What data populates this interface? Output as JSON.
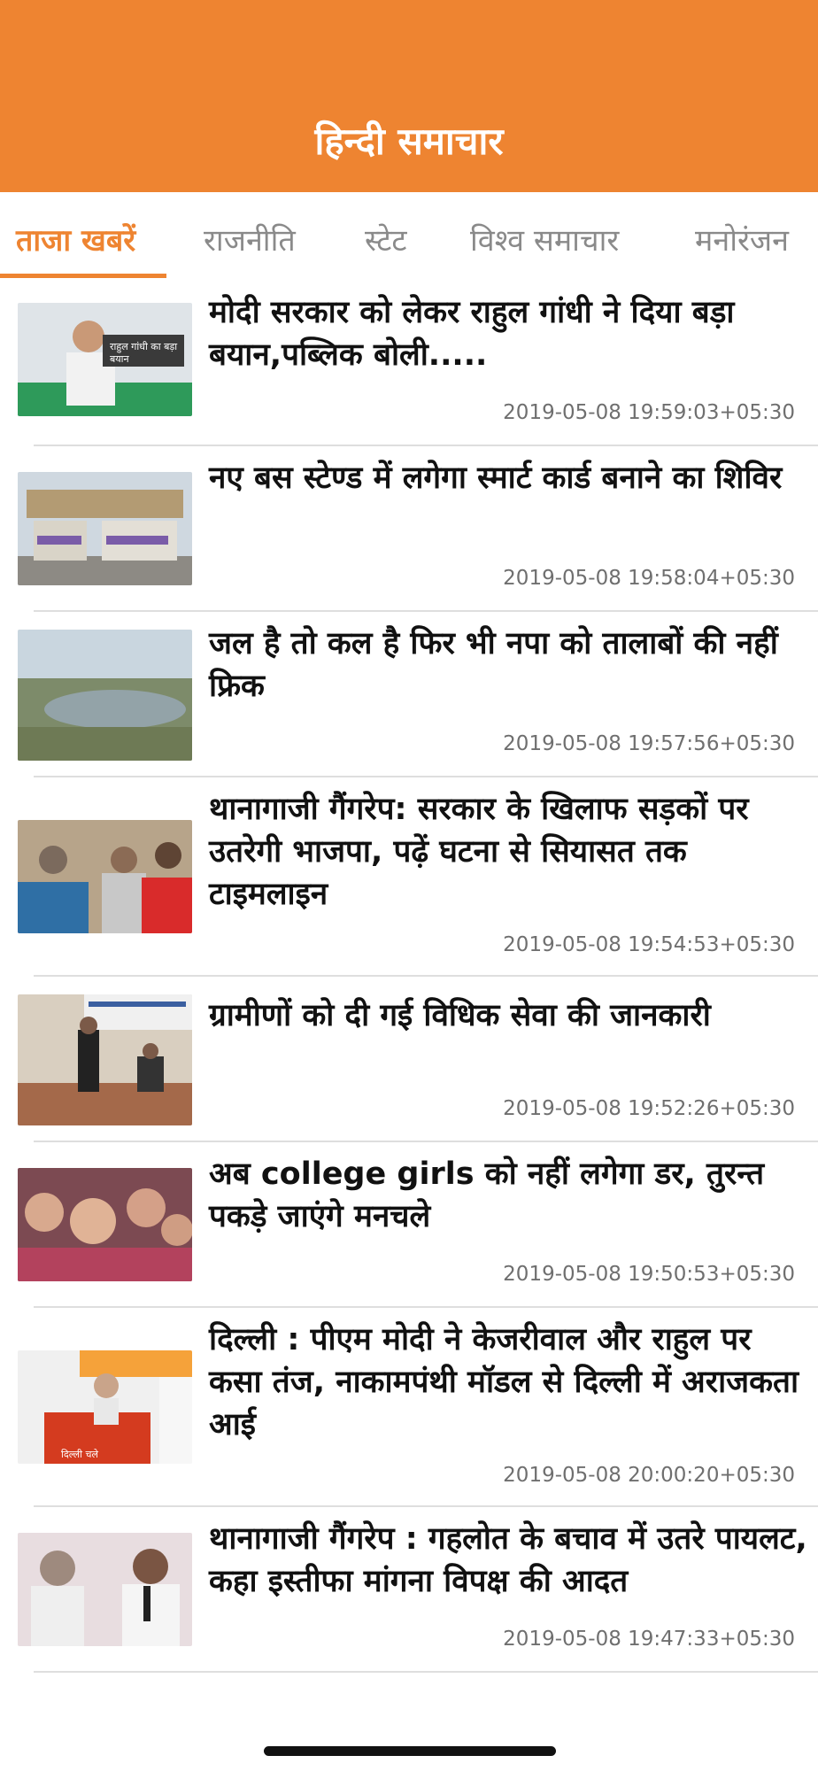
{
  "header": {
    "title": "हिन्दी समाचार",
    "color": "#ee8431"
  },
  "tabs": [
    {
      "label": "ताजा खबरें",
      "active": true
    },
    {
      "label": "राजनीति",
      "active": false
    },
    {
      "label": "स्टेट",
      "active": false
    },
    {
      "label": "विश्व समाचार",
      "active": false
    },
    {
      "label": "मनोरंजन",
      "active": false
    }
  ],
  "news": [
    {
      "headline": "मोदी सरकार को लेकर राहुल गांधी ने दिया बड़ा बयान,पब्लिक बोली.....",
      "timestamp": "2019-05-08 19:59:03+05:30",
      "image_caption": "राहुल गांधी का बड़ा बयान"
    },
    {
      "headline": "नए बस स्टेण्ड में लगेगा स्मार्ट कार्ड बनाने का शिविर",
      "timestamp": "2019-05-08 19:58:04+05:30"
    },
    {
      "headline": "जल है तो कल है फिर भी नपा को तालाबों की नहीं फ्रिक",
      "timestamp": "2019-05-08 19:57:56+05:30"
    },
    {
      "headline": "थानागाजी गैंगरेप: सरकार के खिलाफ सड़कों पर उतरेगी भाजपा, पढ़ें घटना से सियासत तक टाइमलाइन",
      "timestamp": "2019-05-08 19:54:53+05:30"
    },
    {
      "headline": "ग्रामीणों को दी गई विधिक सेवा की जानकारी",
      "timestamp": "2019-05-08 19:52:26+05:30"
    },
    {
      "headline": "अब college girls को नहीं लगेगा डर, तुरन्त पकड़े जाएंगे मनचले",
      "timestamp": "2019-05-08 19:50:53+05:30"
    },
    {
      "headline": "दिल्ली : पीएम मोदी ने केजरीवाल और राहुल पर कसा तंज, नाकामपंथी मॉडल से दिल्ली में अराजकता आई",
      "timestamp": "2019-05-08 20:00:20+05:30",
      "image_caption": "दिल्ली चले"
    },
    {
      "headline": "थानागाजी गैंगरेप : गहलोत के बचाव में उतरे पायलट, कहा इस्तीफा मांगना विपक्ष की आदत",
      "timestamp": "2019-05-08 19:47:33+05:30"
    }
  ]
}
